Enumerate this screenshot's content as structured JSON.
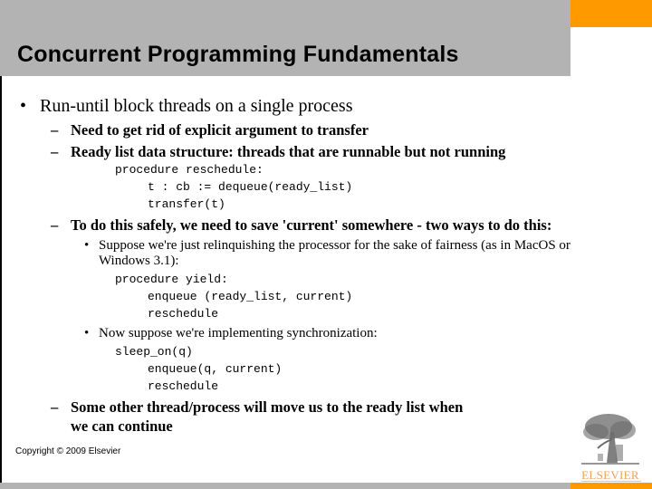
{
  "slide": {
    "title": "Concurrent Programming Fundamentals",
    "colors": {
      "header_gray": "#b3b3b3",
      "accent_orange": "#ff9900",
      "logo_text": "#e8a35a"
    },
    "bullet_marker": "•",
    "dash_marker": "–",
    "items": {
      "b1": "Run-until block threads on a single process",
      "b1_1": "Need to get rid of explicit argument to transfer",
      "b1_2": "Ready list data structure: threads that are runnable but not running",
      "code1": [
        "procedure reschedule:",
        "t : cb := dequeue(ready_list)",
        "transfer(t)"
      ],
      "b1_3": "To do this safely, we need to save 'current' somewhere - two ways to do this:",
      "b1_3_1_line1": "Suppose we're just relinquishing the processor for the sake of fairness (as in MacOS or",
      "b1_3_1_line2": "Windows 3.1):",
      "code2": [
        "procedure yield:",
        "enqueue (ready_list, current)",
        "reschedule"
      ],
      "b1_3_2": "Now suppose we're implementing synchronization:",
      "code3": [
        "sleep_on(q)",
        "enqueue(q, current)",
        "reschedule"
      ],
      "b1_4_line1": "Some other thread/process will move us to the ready list when",
      "b1_4_line2": "we can continue"
    },
    "copyright": "Copyright © 2009 Elsevier",
    "logo": {
      "icon": "elsevier-tree-icon",
      "text": "ELSEVIER"
    }
  }
}
